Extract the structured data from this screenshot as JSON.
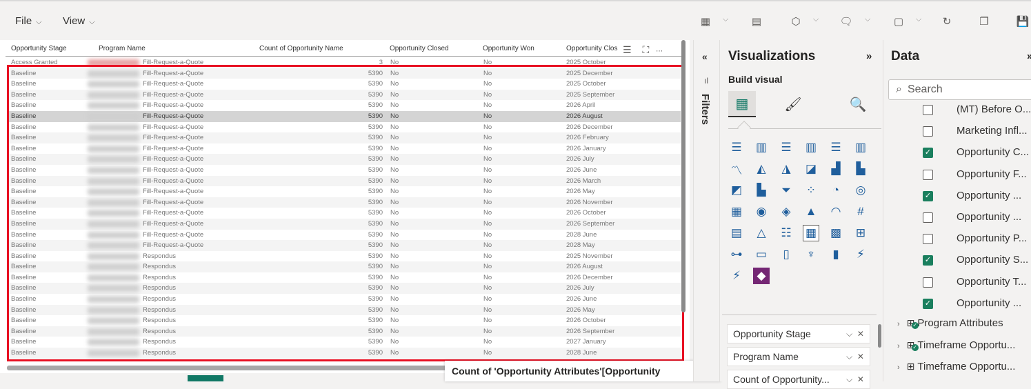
{
  "menu": {
    "file": "File",
    "view": "View"
  },
  "table": {
    "columns": [
      "Opportunity Stage",
      "Program Name",
      "Count of Opportunity Name",
      "Opportunity Closed",
      "Opportunity Won",
      "Opportunity Clos"
    ],
    "rows": [
      [
        "Access Granted",
        "Fill-Request-a-Quote",
        "3",
        "No",
        "No",
        "2025 October"
      ],
      [
        "Baseline",
        "Fill-Request-a-Quote",
        "5390",
        "No",
        "No",
        "2025 December"
      ],
      [
        "Baseline",
        "Fill-Request-a-Quote",
        "5390",
        "No",
        "No",
        "2025 October"
      ],
      [
        "Baseline",
        "Fill-Request-a-Quote",
        "5390",
        "No",
        "No",
        "2025 September"
      ],
      [
        "Baseline",
        "Fill-Request-a-Quote",
        "5390",
        "No",
        "No",
        "2026 April"
      ],
      [
        "Baseline",
        "Fill-Request-a-Quote",
        "5390",
        "No",
        "No",
        "2026 August"
      ],
      [
        "Baseline",
        "Fill-Request-a-Quote",
        "5390",
        "No",
        "No",
        "2026 December"
      ],
      [
        "Baseline",
        "Fill-Request-a-Quote",
        "5390",
        "No",
        "No",
        "2026 February"
      ],
      [
        "Baseline",
        "Fill-Request-a-Quote",
        "5390",
        "No",
        "No",
        "2026 January"
      ],
      [
        "Baseline",
        "Fill-Request-a-Quote",
        "5390",
        "No",
        "No",
        "2026 July"
      ],
      [
        "Baseline",
        "Fill-Request-a-Quote",
        "5390",
        "No",
        "No",
        "2026 June"
      ],
      [
        "Baseline",
        "Fill-Request-a-Quote",
        "5390",
        "No",
        "No",
        "2026 March"
      ],
      [
        "Baseline",
        "Fill-Request-a-Quote",
        "5390",
        "No",
        "No",
        "2026 May"
      ],
      [
        "Baseline",
        "Fill-Request-a-Quote",
        "5390",
        "No",
        "No",
        "2026 November"
      ],
      [
        "Baseline",
        "Fill-Request-a-Quote",
        "5390",
        "No",
        "No",
        "2026 October"
      ],
      [
        "Baseline",
        "Fill-Request-a-Quote",
        "5390",
        "No",
        "No",
        "2026 September"
      ],
      [
        "Baseline",
        "Fill-Request-a-Quote",
        "5390",
        "No",
        "No",
        "2028 June"
      ],
      [
        "Baseline",
        "Fill-Request-a-Quote",
        "5390",
        "No",
        "No",
        "2028 May"
      ],
      [
        "Baseline",
        "Respondus",
        "5390",
        "No",
        "No",
        "2025 November"
      ],
      [
        "Baseline",
        "Respondus",
        "5390",
        "No",
        "No",
        "2026 August"
      ],
      [
        "Baseline",
        "Respondus",
        "5390",
        "No",
        "No",
        "2026 December"
      ],
      [
        "Baseline",
        "Respondus",
        "5390",
        "No",
        "No",
        "2026 July"
      ],
      [
        "Baseline",
        "Respondus",
        "5390",
        "No",
        "No",
        "2026 June"
      ],
      [
        "Baseline",
        "Respondus",
        "5390",
        "No",
        "No",
        "2026 May"
      ],
      [
        "Baseline",
        "Respondus",
        "5390",
        "No",
        "No",
        "2026 October"
      ],
      [
        "Baseline",
        "Respondus",
        "5390",
        "No",
        "No",
        "2026 September"
      ],
      [
        "Baseline",
        "Respondus",
        "5390",
        "No",
        "No",
        "2027 January"
      ],
      [
        "Baseline",
        "Respondus",
        "5390",
        "No",
        "No",
        "2028 June"
      ]
    ],
    "selected_row": 5
  },
  "tooltip": {
    "text": "Count of 'Opportunity Attributes'[Opportunity"
  },
  "filters": {
    "label": "Filters"
  },
  "visualizations": {
    "title": "Visualizations",
    "build_visual": "Build visual",
    "wells": [
      "Opportunity Stage",
      "Program Name",
      "Count of Opportunity..."
    ]
  },
  "data_pane": {
    "title": "Data",
    "search_placeholder": "Search",
    "fields": [
      {
        "label": "(MT) Before O...",
        "checked": false
      },
      {
        "label": "Marketing Infl...",
        "checked": false
      },
      {
        "label": "Opportunity C...",
        "checked": true
      },
      {
        "label": "Opportunity F...",
        "checked": false
      },
      {
        "label": "Opportunity ...",
        "checked": true
      },
      {
        "label": "Opportunity ...",
        "checked": false
      },
      {
        "label": "Opportunity P...",
        "checked": false
      },
      {
        "label": "Opportunity S...",
        "checked": true
      },
      {
        "label": "Opportunity T...",
        "checked": false
      },
      {
        "label": "Opportunity ...",
        "checked": true
      }
    ],
    "tables": [
      "Program Attributes",
      "Timeframe Opportu...",
      "Timeframe Opportu..."
    ]
  },
  "colors": {
    "accent_green": "#117865",
    "checkbox_green": "#1a7f5e",
    "selection_red": "#e81123"
  }
}
